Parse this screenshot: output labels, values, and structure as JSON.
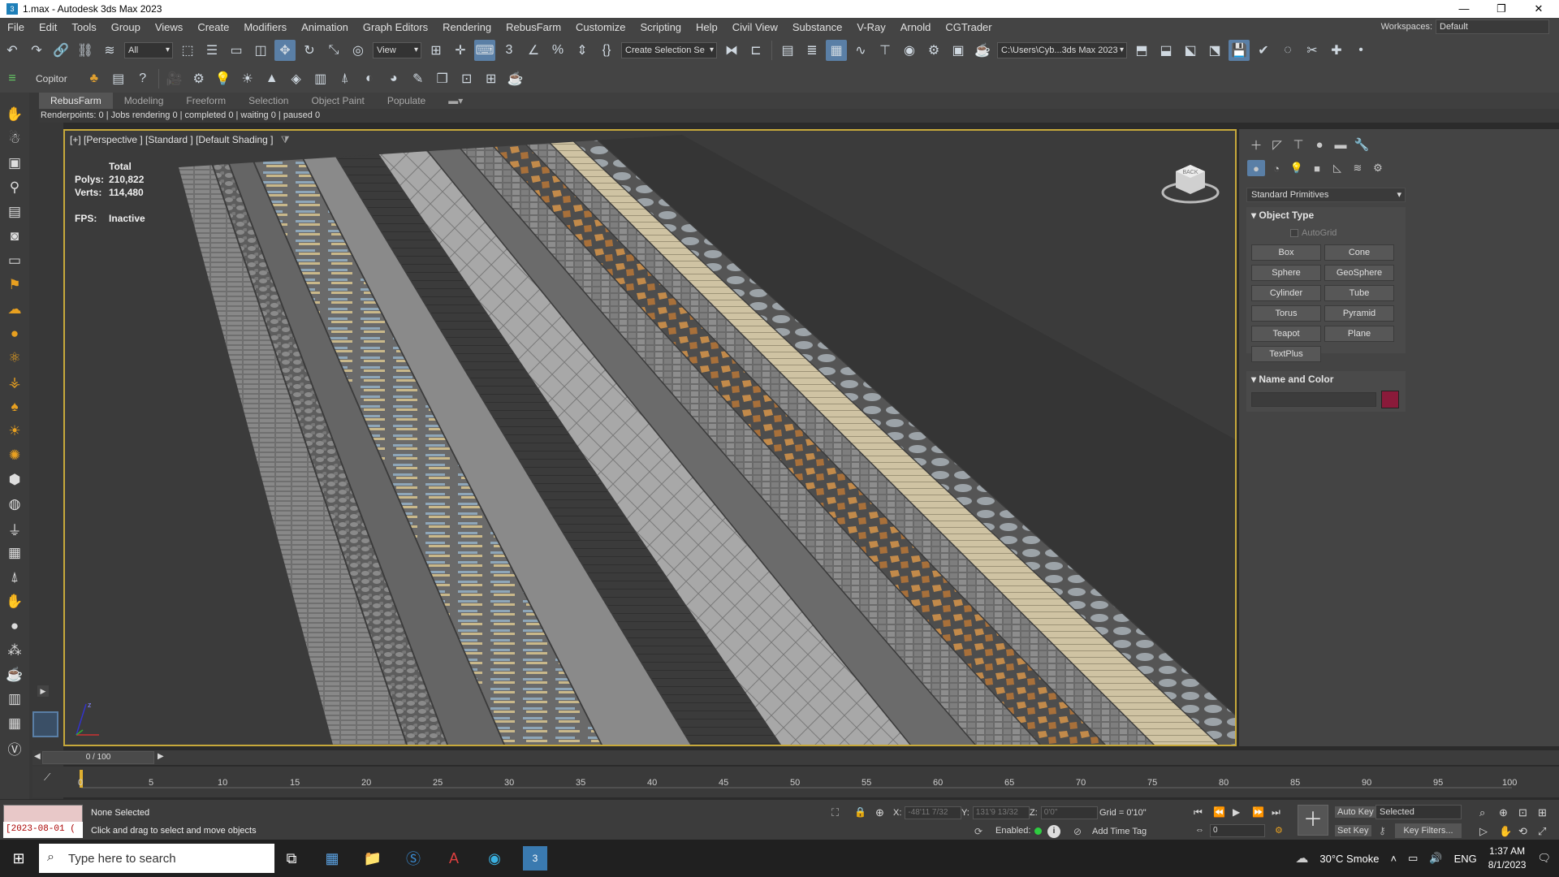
{
  "titlebar": {
    "title": "1.max - Autodesk 3ds Max 2023",
    "app_icon": "3ds-max-icon"
  },
  "menus": [
    "File",
    "Edit",
    "Tools",
    "Group",
    "Views",
    "Create",
    "Modifiers",
    "Animation",
    "Graph Editors",
    "Rendering",
    "RebusFarm",
    "Customize",
    "Scripting",
    "Help",
    "Civil View",
    "Substance",
    "V-Ray",
    "Arnold",
    "CGTrader"
  ],
  "workspace": {
    "label": "Workspaces:",
    "value": "Default"
  },
  "toolbar": {
    "selection_filter": "All",
    "ref_coord": "View",
    "named_selection": "Create Selection Se",
    "project_path": "C:\\Users\\Cyb...3ds Max 2023"
  },
  "toolbar2": {
    "copitor_label": "Copitor"
  },
  "ribbon": {
    "tabs": [
      "RebusFarm",
      "Modeling",
      "Freeform",
      "Selection",
      "Object Paint",
      "Populate"
    ],
    "active": "RebusFarm"
  },
  "render_status": "Renderpoints: 0 | Jobs rendering 0 | completed 0 | waiting 0 | paused 0",
  "viewport": {
    "label": "[+] [Perspective ] [Standard ] [Default Shading ]",
    "stats": {
      "total_label": "Total",
      "polys_label": "Polys:",
      "polys": "210,822",
      "verts_label": "Verts:",
      "verts": "114,480",
      "fps_label": "FPS:",
      "fps": "Inactive"
    },
    "viewcube_label": "BACK"
  },
  "command_panel": {
    "primitive_type": "Standard Primitives",
    "object_type_title": "Object Type",
    "autogrid": "AutoGrid",
    "buttons": [
      "Box",
      "Cone",
      "Sphere",
      "GeoSphere",
      "Cylinder",
      "Tube",
      "Torus",
      "Pyramid",
      "Teapot",
      "Plane",
      "TextPlus"
    ],
    "name_color_title": "Name and Color",
    "color": "#8a1a3a"
  },
  "timeslider": {
    "value": "0 / 100"
  },
  "trackbar_ticks": [
    "0",
    "5",
    "10",
    "15",
    "20",
    "25",
    "30",
    "35",
    "40",
    "45",
    "50",
    "55",
    "60",
    "65",
    "70",
    "75",
    "80",
    "85",
    "90",
    "95",
    "100"
  ],
  "status": {
    "selection": "None Selected",
    "hint": "Click and drag to select and move objects",
    "maxscript_value": "[2023-08-01 (",
    "x_label": "X:",
    "x": "-48'11 7/32",
    "y_label": "Y:",
    "y": "131'9 13/32",
    "z_label": "Z:",
    "z": "0'0\"",
    "grid": "Grid = 0'10\"",
    "enabled_label": "Enabled:",
    "add_time_tag": "Add Time Tag",
    "auto_key": "Auto Key",
    "key_mode": "Selected",
    "set_key": "Set Key",
    "key_filters": "Key Filters...",
    "frame": "0"
  },
  "taskbar": {
    "search_placeholder": "Type here to search",
    "weather": "30°C  Smoke",
    "lang": "ENG",
    "time": "1:37 AM",
    "date": "8/1/2023"
  }
}
